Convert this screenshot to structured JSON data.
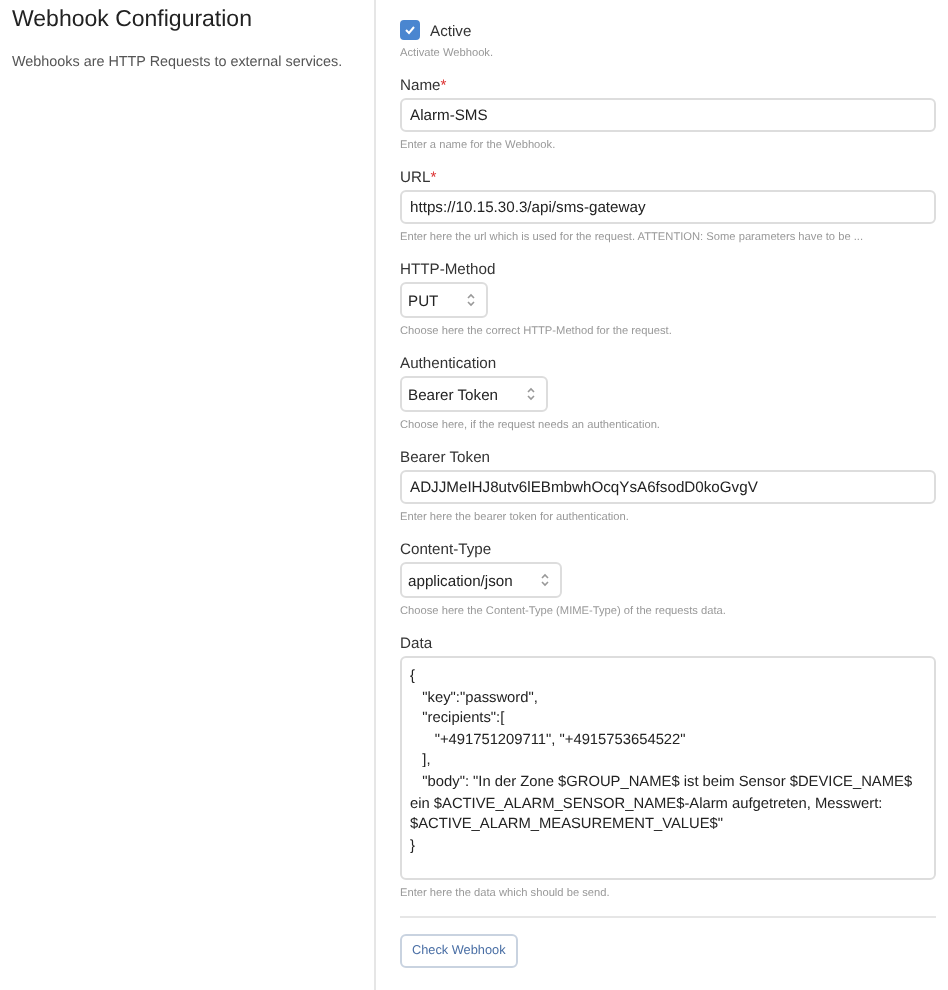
{
  "section": {
    "title": "Webhook Configuration",
    "description": "Webhooks are HTTP Requests to external services."
  },
  "fields": [
    {
      "kind": "checkbox",
      "label": "Active",
      "checked": true,
      "hint": "Activate Webhook."
    },
    {
      "kind": "text",
      "label": "Name",
      "required_mark": "*",
      "value": "Alarm-SMS",
      "hint": "Enter a name for the Webhook."
    },
    {
      "kind": "text",
      "label": "URL",
      "required_mark": "*",
      "value": "https://10.15.30.3/api/sms-gateway",
      "hint": "Enter here the url which is used for the request. ATTENTION: Some parameters have to be ..."
    },
    {
      "kind": "select",
      "label": "HTTP-Method",
      "value": "PUT",
      "hint": "Choose here the correct HTTP-Method for the request."
    },
    {
      "kind": "select",
      "label": "Authentication",
      "value": "Bearer Token",
      "hint": "Choose here, if the request needs an authentication."
    },
    {
      "kind": "text",
      "label": "Bearer Token",
      "value": "ADJJMeIHJ8utv6lEBmbwhOcqYsA6fsodD0koGvgV",
      "hint": "Enter here the bearer token for authentication."
    },
    {
      "kind": "select",
      "label": "Content-Type",
      "value": "application/json",
      "hint": "Choose here the Content-Type (MIME-Type) of the requests data."
    },
    {
      "kind": "textarea",
      "label": "Data",
      "value": "{\n   \"key\":\"password\",\n   \"recipients\":[\n      \"+491751209711\", \"+4915753654522\"\n   ],\n   \"body\": \"In der Zone $GROUP_NAME$ ist beim Sensor $DEVICE_NAME$ ein $ACTIVE_ALARM_SENSOR_NAME$-Alarm aufgetreten, Messwert: $ACTIVE_ALARM_MEASUREMENT_VALUE$\"\n}",
      "hint": "Enter here the data which should be send."
    }
  ],
  "button": "Check Webhook"
}
